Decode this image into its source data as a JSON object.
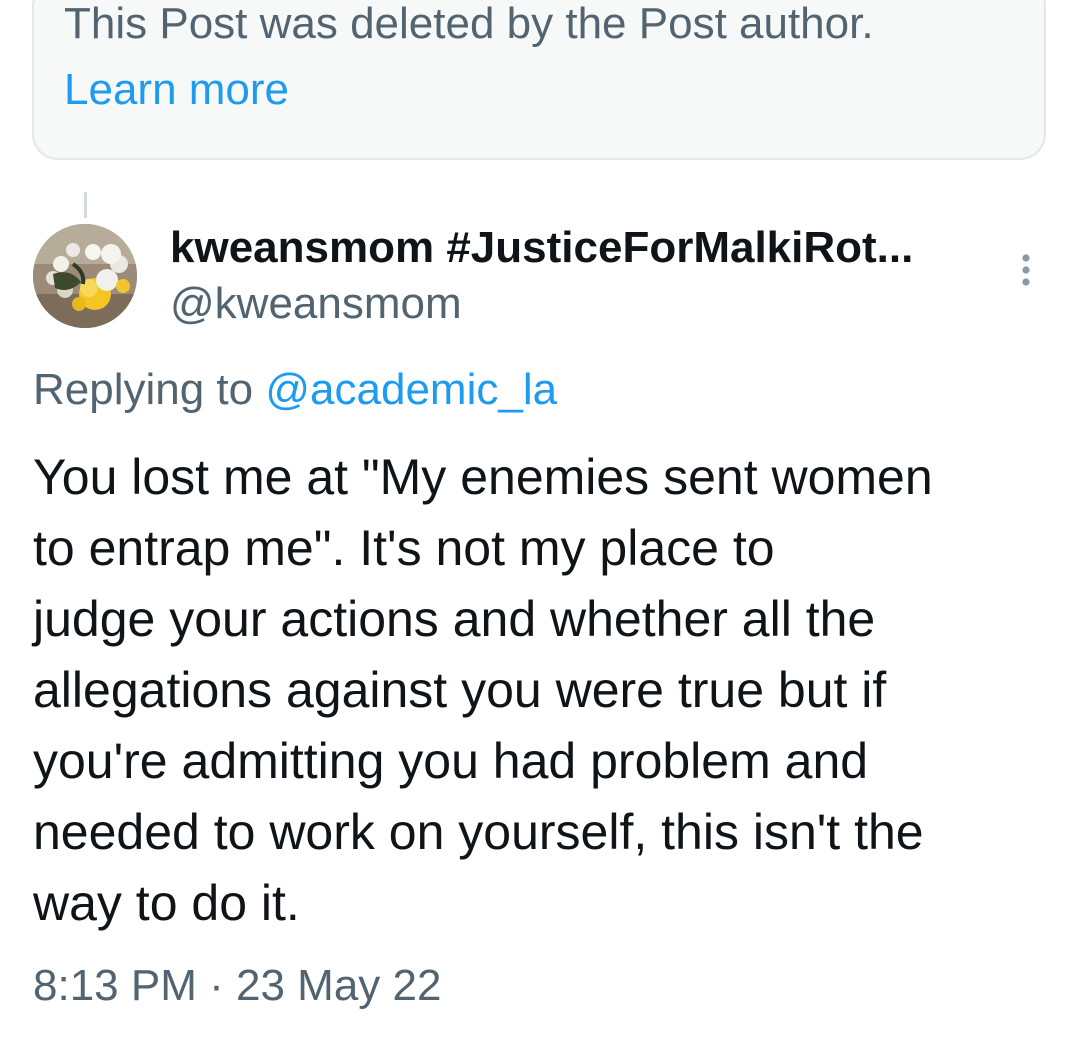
{
  "notice": {
    "text": "This Post was deleted by the Post author.",
    "link": "Learn more"
  },
  "author": {
    "display_name": "kweansmom #JusticeForMalkiRot...",
    "handle": "@kweansmom",
    "avatar_icon": "flower-bouquet-avatar"
  },
  "menu": {
    "icon": "more-vertical-icon"
  },
  "reply_context": {
    "prefix": "Replying to",
    "mention": "@academic_la"
  },
  "tweet": {
    "lines": [
      "You lost me at \"My enemies sent women",
      "to entrap me\". It's not my place to",
      "judge your actions and whether all the",
      "allegations against you were true but if",
      "you're admitting you had problem and",
      "needed to work on yourself, this isn't the",
      "way to do it."
    ]
  },
  "meta": {
    "time": "8:13 PM",
    "separator": "·",
    "date": "23 May 22"
  },
  "colors": {
    "text_primary": "#0f1419",
    "text_secondary": "#536471",
    "accent": "#1d9bf0",
    "notice_bg": "#f7f9f9",
    "border": "#e1e8ed"
  }
}
